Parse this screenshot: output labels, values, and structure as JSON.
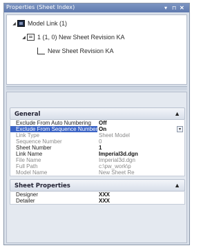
{
  "panel": {
    "title": "Properties (Sheet Index)",
    "buttons": {
      "dropdown": "▾",
      "pin": "⊓",
      "close": "✕"
    }
  },
  "tree": {
    "items": [
      {
        "expander": "◢",
        "label": "Model Link (1)",
        "icon": "model-link-icon"
      },
      {
        "expander": "◢",
        "label": "1 (1, 0) New Sheet Revision KA",
        "icon": "sheet-icon"
      },
      {
        "expander": "",
        "label": "New Sheet Revision KA",
        "icon": "page-corner-icon"
      }
    ]
  },
  "general": {
    "title": "General",
    "chevron": "▲",
    "rows": [
      {
        "key": "Exclude From Auto Numbering",
        "value": "Off",
        "style": "bold"
      },
      {
        "key": "Exclude From Sequence Number",
        "value": "On",
        "style": "selected"
      },
      {
        "key": "Link Type",
        "value": "Sheet Model",
        "style": "dim"
      },
      {
        "key": "Sequence Number",
        "value": "0",
        "style": "dim"
      },
      {
        "key": "Sheet Number",
        "value": "1",
        "style": "bold"
      },
      {
        "key": "Link Name",
        "value": "Imperial3d.dgn",
        "style": "bold"
      },
      {
        "key": "File Name",
        "value": "Imperial3d.dgn",
        "style": "dim"
      },
      {
        "key": "Full Path",
        "value": "c:\\pw_work\\p",
        "style": "dim"
      },
      {
        "key": "Model Name",
        "value": "New Sheet Re",
        "style": "dim"
      }
    ]
  },
  "sheet_properties": {
    "title": "Sheet Properties",
    "chevron": "▲",
    "rows": [
      {
        "key": "Designer",
        "value": "XXX",
        "style": "bold"
      },
      {
        "key": "Detailer",
        "value": "XXX",
        "style": "bold"
      }
    ]
  },
  "dropdown_arrow": "▾"
}
